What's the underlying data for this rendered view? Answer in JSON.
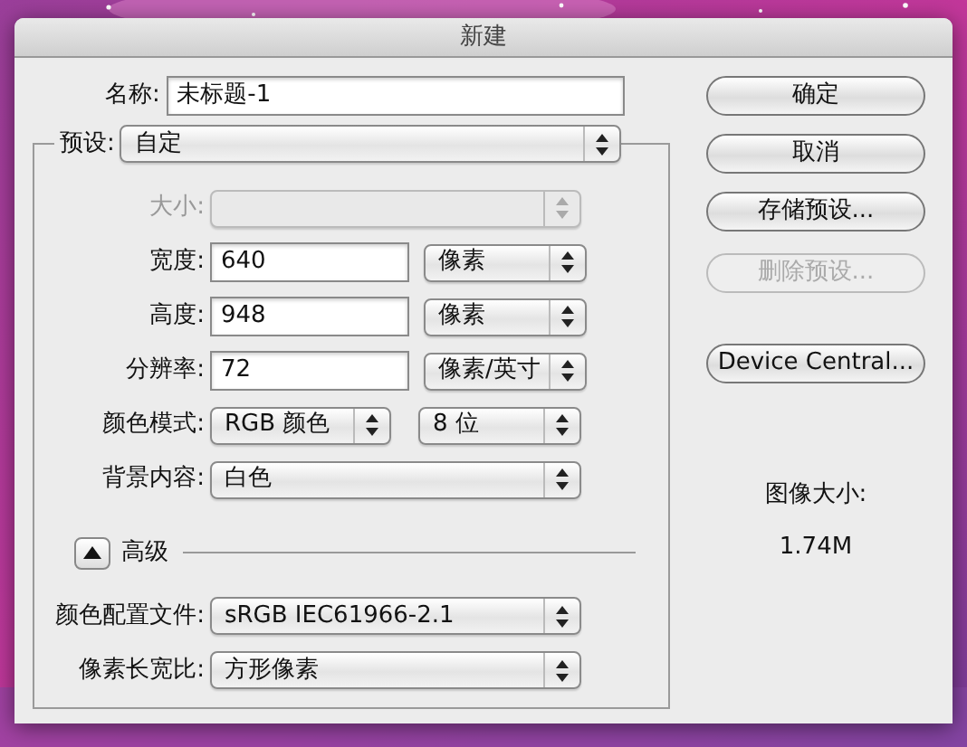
{
  "window": {
    "title": "新建"
  },
  "name_field": {
    "label": "名称:",
    "value": "未标题-1"
  },
  "preset": {
    "label": "预设:",
    "value": "自定"
  },
  "fields": [
    {
      "kind": "select",
      "label": "大小:",
      "disabled": true
    },
    {
      "kind": "input",
      "label": "宽度:",
      "value": "640",
      "unit": "像素",
      "disabled": false
    },
    {
      "kind": "input",
      "label": "高度:",
      "value": "948",
      "unit": "像素",
      "disabled": false
    },
    {
      "kind": "input",
      "label": "分辨率:",
      "value": "72",
      "unit": "像素/英寸",
      "disabled": false
    },
    {
      "kind": "pair",
      "label": "颜色模式:",
      "value": "RGB 颜色",
      "unit": "8 位",
      "disabled": false
    },
    {
      "kind": "select",
      "label": "背景内容:",
      "value": "白色",
      "disabled": false
    }
  ],
  "advanced": {
    "label": "高级",
    "expanded": true
  },
  "advanced_fields": [
    {
      "label": "颜色配置文件:",
      "value": "sRGB IEC61966-2.1"
    },
    {
      "label": "像素长宽比:",
      "value": "方形像素"
    }
  ],
  "buttons": [
    {
      "label": "确定",
      "disabled": false
    },
    {
      "label": "取消",
      "disabled": false
    },
    {
      "label": "存储预设...",
      "disabled": false
    },
    {
      "label": "删除预设...",
      "disabled": true
    },
    {
      "label": "Device Central...",
      "disabled": false
    }
  ],
  "image_size": {
    "label": "图像大小:",
    "value": "1.74M"
  }
}
